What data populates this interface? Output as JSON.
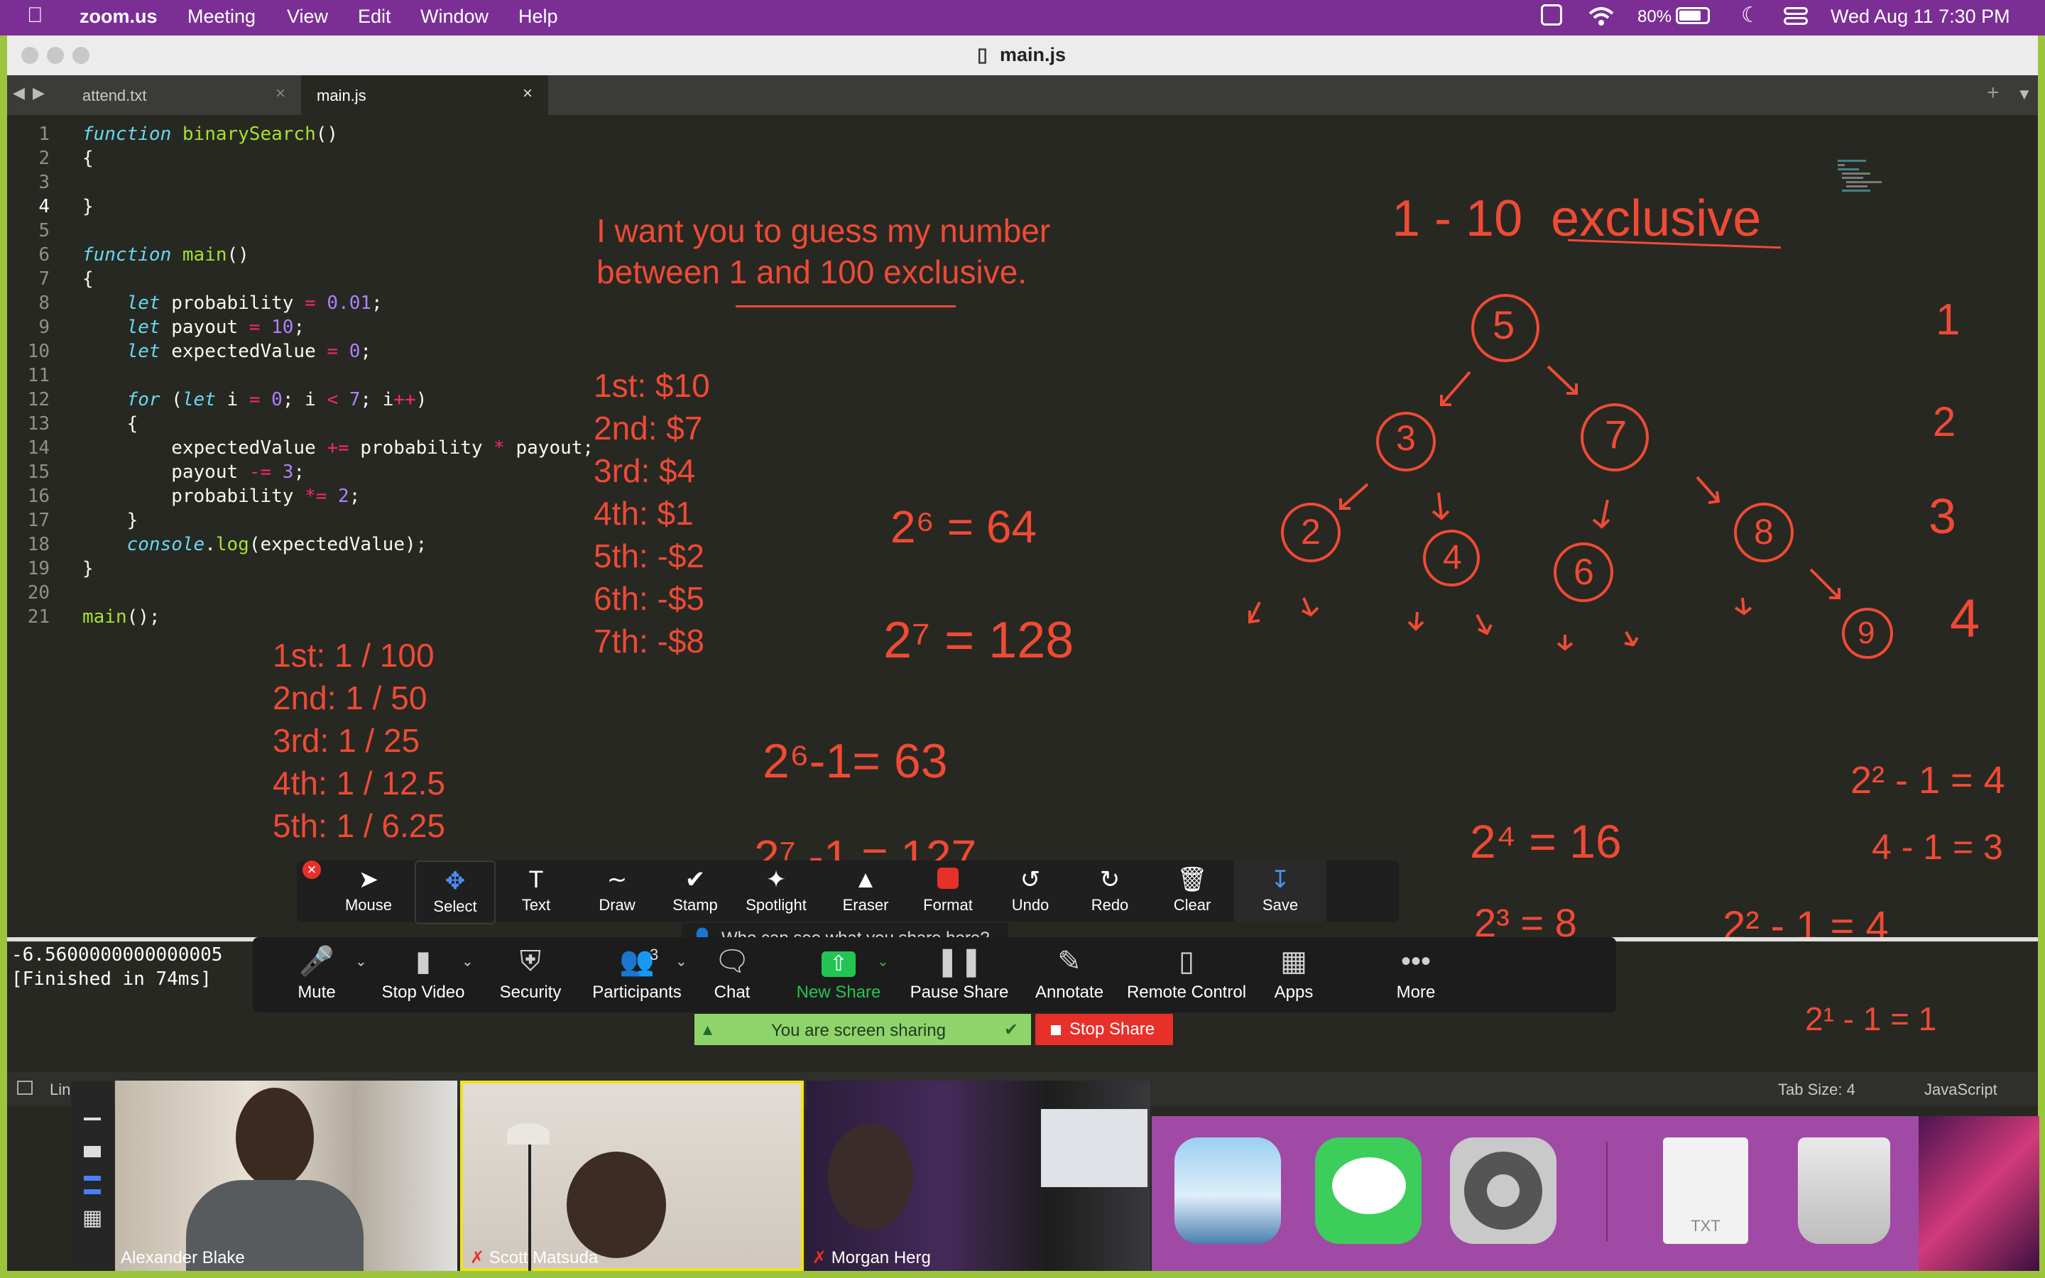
{
  "menubar": {
    "apple_icon": "apple-logo-icon",
    "app": "zoom.us",
    "items": [
      "Meeting",
      "View",
      "Edit",
      "Window",
      "Help"
    ],
    "battery": "80%",
    "datetime": "Wed Aug 11  7:30 PM"
  },
  "window": {
    "title": "main.js",
    "tabs": [
      {
        "label": "attend.txt",
        "active": false
      },
      {
        "label": "main.js",
        "active": true
      }
    ]
  },
  "code": {
    "lines": [
      "function binarySearch()",
      "{",
      "",
      "}",
      "",
      "function main()",
      "{",
      "    let probability = 0.01;",
      "    let payout = 10;",
      "    let expectedValue = 0;",
      "",
      "    for (let i = 0; i < 7; i++)",
      "    {",
      "        expectedValue += probability * payout;",
      "        payout -= 3;",
      "        probability *= 2;",
      "    }",
      "    console.log(expectedValue);",
      "}",
      "",
      "main();"
    ],
    "current_line": 4
  },
  "console": {
    "output": "-6.5600000000000005",
    "finished": "[Finished in 74ms]"
  },
  "annotations": {
    "prompt_line1": "I want you to guess my number",
    "prompt_line2": "between 1 and 100 exclusive.",
    "payouts": [
      "1st: $10",
      "2nd: $7",
      "3rd: $4",
      "4th: $1",
      "5th: -$2",
      "6th: -$5",
      "7th: -$8"
    ],
    "odds": [
      "1st: 1 / 100",
      "2nd: 1 / 50",
      "3rd: 1 / 25",
      "4th: 1 / 12.5",
      "5th: 1 / 6.25"
    ],
    "math_2_6": "2⁶ = 64",
    "math_2_7": "2⁷ = 128",
    "math_2_6_minus": "2⁶-1= 63",
    "math_2_7_minus": "2⁷ -1 = 127",
    "range_header": "1 - 10  exclusive",
    "tree_nodes": [
      "5",
      "3",
      "7",
      "2",
      "4",
      "6",
      "8",
      "9"
    ],
    "right_column": [
      "1",
      "2",
      "3",
      "4"
    ],
    "math_2_4": "2⁴ = 16",
    "math_2_3": "2³ = 8",
    "math_2_2_minus": "2² - 1 = 4",
    "math_4_minus": "4 - 1 = 3",
    "math_2_1_minus": "2¹ - 1 = 1",
    "math_2_2b_minus": "2² - 1 = 4"
  },
  "annotate_toolbar": {
    "close_icon": "close-icon",
    "buttons": [
      {
        "label": "Mouse",
        "icon": "cursor-icon"
      },
      {
        "label": "Select",
        "icon": "move-icon"
      },
      {
        "label": "Text",
        "icon": "text-icon"
      },
      {
        "label": "Draw",
        "icon": "squiggle-icon"
      },
      {
        "label": "Stamp",
        "icon": "check-icon"
      },
      {
        "label": "Spotlight",
        "icon": "wand-icon"
      },
      {
        "label": "Eraser",
        "icon": "eraser-icon"
      },
      {
        "label": "Format",
        "icon": "format-swatch-icon"
      },
      {
        "label": "Undo",
        "icon": "undo-icon"
      },
      {
        "label": "Redo",
        "icon": "redo-icon"
      },
      {
        "label": "Clear",
        "icon": "trash-icon"
      },
      {
        "label": "Save",
        "icon": "save-icon"
      }
    ],
    "format_color": "#e8302a"
  },
  "share_tooltip": "Who can see what you share here?",
  "meeting_controls": {
    "buttons": [
      {
        "label": "Mute",
        "icon": "microphone-icon"
      },
      {
        "label": "Stop Video",
        "icon": "video-camera-icon"
      },
      {
        "label": "Security",
        "icon": "shield-icon"
      },
      {
        "label": "Participants",
        "icon": "participants-icon",
        "count": "3"
      },
      {
        "label": "Chat",
        "icon": "chat-bubble-icon"
      },
      {
        "label": "New Share",
        "icon": "share-arrow-icon"
      },
      {
        "label": "Pause Share",
        "icon": "pause-icon"
      },
      {
        "label": "Annotate",
        "icon": "pencil-icon"
      },
      {
        "label": "Remote Control",
        "icon": "mouse-icon"
      },
      {
        "label": "Apps",
        "icon": "apps-icon"
      },
      {
        "label": "More",
        "icon": "ellipsis-icon"
      }
    ],
    "accent_green": "#23c552"
  },
  "share_bar": {
    "status": "You are screen sharing",
    "stop_label": "Stop Share"
  },
  "status_bar": {
    "line_prefix": "Lin",
    "tab_size": "Tab Size: 4",
    "syntax": "JavaScript"
  },
  "videos": [
    {
      "name": "Alexander Blake",
      "muted": false
    },
    {
      "name": "Scott Matsuda",
      "muted": true
    },
    {
      "name": "Morgan Herg",
      "muted": true
    }
  ],
  "dock": {
    "apps": [
      "preview-icon",
      "messages-icon",
      "system-preferences-icon",
      "txt-file-icon",
      "trash-icon"
    ],
    "txt_label": "TXT"
  },
  "colors": {
    "menubar_bg": "#7b2f95",
    "editor_bg": "#272822",
    "annotation_red": "#f04a35",
    "frame_green": "#9bc53d"
  }
}
